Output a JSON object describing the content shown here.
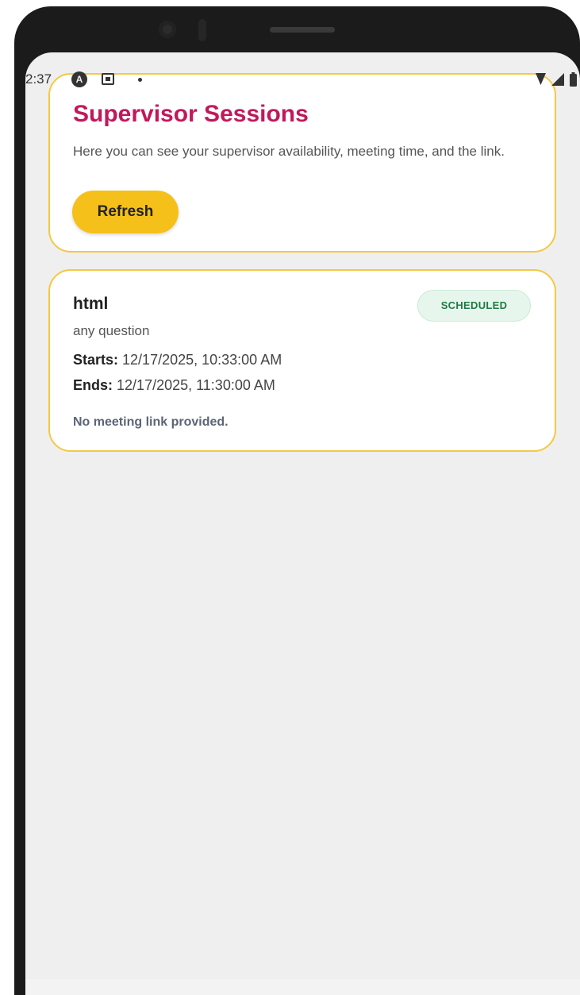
{
  "status_bar": {
    "time": "2:37",
    "notification_icon_a": "A"
  },
  "header_card": {
    "title": "Supervisor Sessions",
    "description": "Here you can see your supervisor availability, meeting time, and the link.",
    "refresh_label": "Refresh"
  },
  "sessions": [
    {
      "title": "html",
      "description": "any question",
      "status": "SCHEDULED",
      "starts_label": "Starts:",
      "starts_value": "12/17/2025, 10:33:00 AM",
      "ends_label": "Ends:",
      "ends_value": "12/17/2025, 11:30:00 AM",
      "link_text": "No meeting link provided."
    }
  ],
  "colors": {
    "accent_title": "#c2185b",
    "button_yellow": "#f5c01a",
    "card_border": "#f5c842",
    "badge_green": "#1f7a45",
    "badge_bg": "#e7f6ec",
    "screen_bg": "#efefef"
  },
  "icons": {
    "status_left": [
      "circle-a-icon",
      "square-notification-icon",
      "dot-icon"
    ],
    "status_right": [
      "wifi-icon",
      "signal-icon",
      "battery-icon"
    ]
  }
}
